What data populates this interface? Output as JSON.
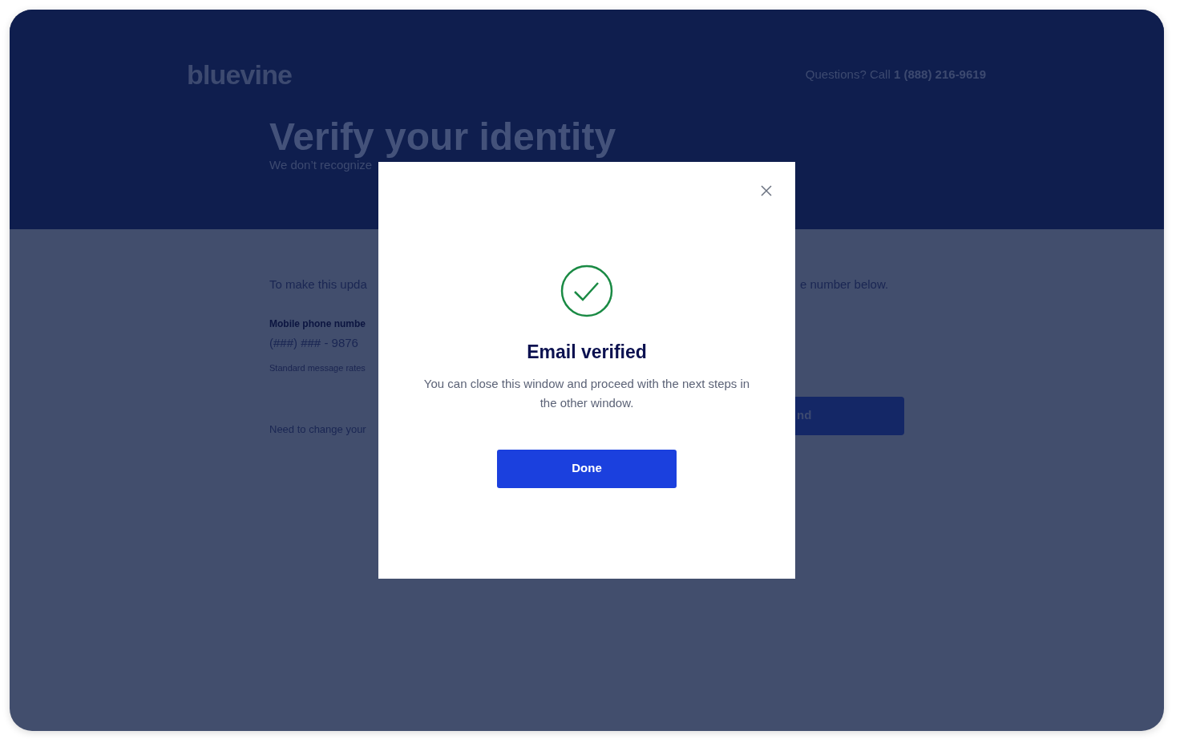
{
  "header": {
    "logo": "bluevine",
    "help_text": "Questions? Call **1 (888) 216-9619**"
  },
  "page": {
    "title": "Verify your identity",
    "subtitle": "We don’t recognize",
    "intro_left": "To make this upda",
    "intro_right": "e number below.",
    "phone_label": "Mobile phone numbe",
    "phone_value": "(###) ### - 9876",
    "note": "Standard message rates",
    "change_prompt": "Need to change your",
    "button_fragment": "nd"
  },
  "modal": {
    "title": "Email verified",
    "message": "You can close this window and proceed with the next steps in the other window.",
    "button": "Done"
  }
}
